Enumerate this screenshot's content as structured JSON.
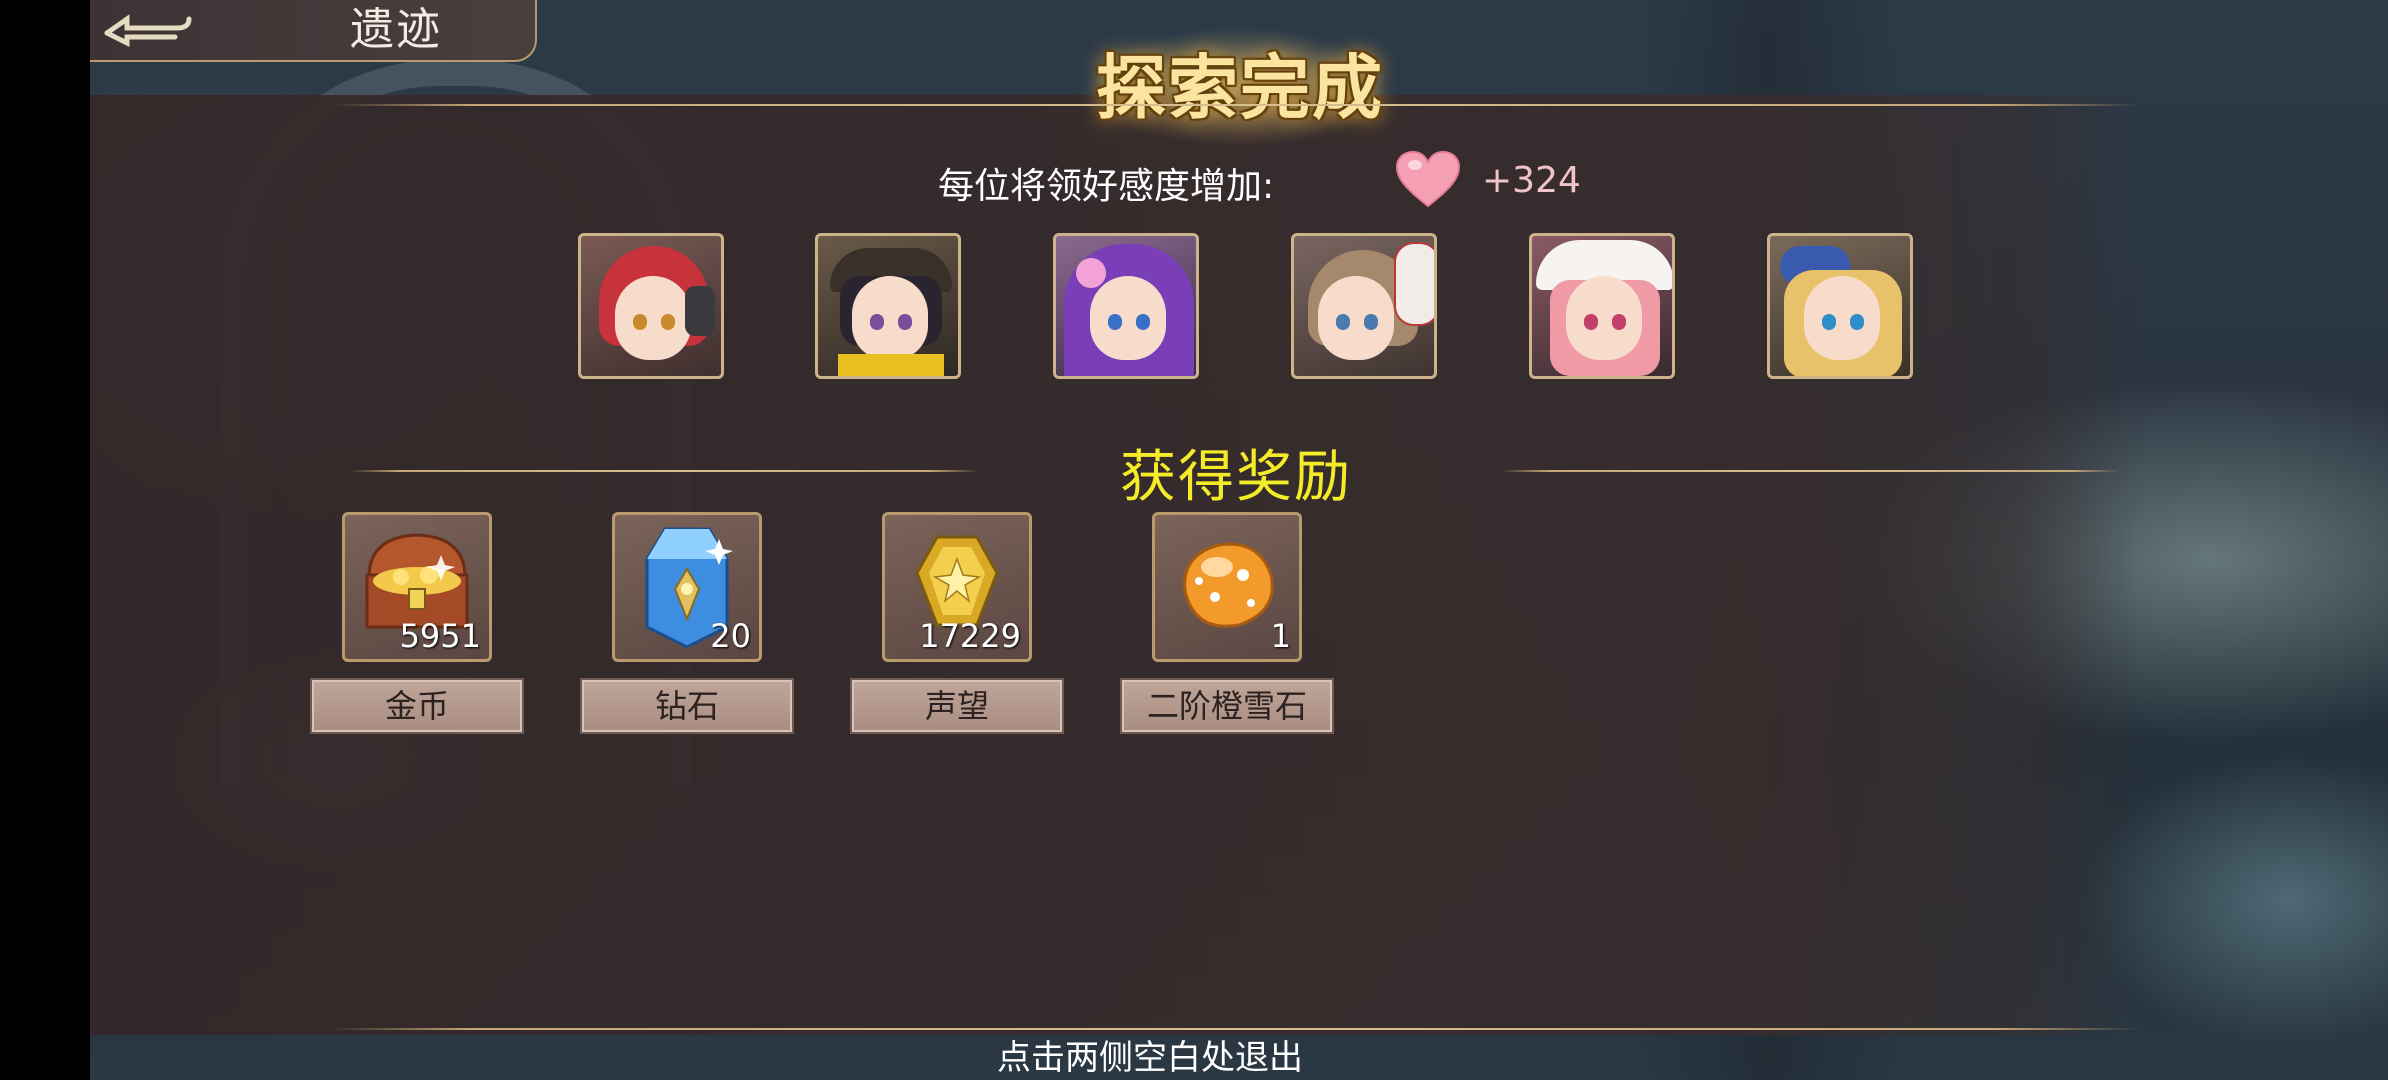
{
  "header": {
    "back_icon": "back-arrow-icon",
    "title": "遗迹"
  },
  "banner": {
    "title": "探索完成"
  },
  "affinity": {
    "label": "每位将领好感度增加:",
    "icon": "heart-icon",
    "value": "+324"
  },
  "characters": [
    {
      "name": "character-portrait-1",
      "hair": "#c8323a"
    },
    {
      "name": "character-portrait-2",
      "hair": "#2a2430"
    },
    {
      "name": "character-portrait-3",
      "hair": "#7a3fb8"
    },
    {
      "name": "character-portrait-4",
      "hair": "#a6886c"
    },
    {
      "name": "character-portrait-5",
      "hair": "#f09aa6"
    },
    {
      "name": "character-portrait-6",
      "hair": "#e8c26a"
    }
  ],
  "rewards_section": {
    "title": "获得奖励"
  },
  "rewards": [
    {
      "icon": "treasure-chest-icon",
      "count": "5951",
      "name": "金币"
    },
    {
      "icon": "diamond-crystal-icon",
      "count": "20",
      "name": "钻石"
    },
    {
      "icon": "prestige-badge-icon",
      "count": "17229",
      "name": "声望"
    },
    {
      "icon": "orange-snow-stone-icon",
      "count": "1",
      "name": "二阶橙雪石"
    }
  ],
  "footer": {
    "hint": "点击两侧空白处退出"
  },
  "colors": {
    "reward_title": "#f4ec27",
    "banner_gold": "#fbe3a0",
    "affinity_value": "#f2c3c8",
    "frame_gold": "#cdb38a"
  }
}
